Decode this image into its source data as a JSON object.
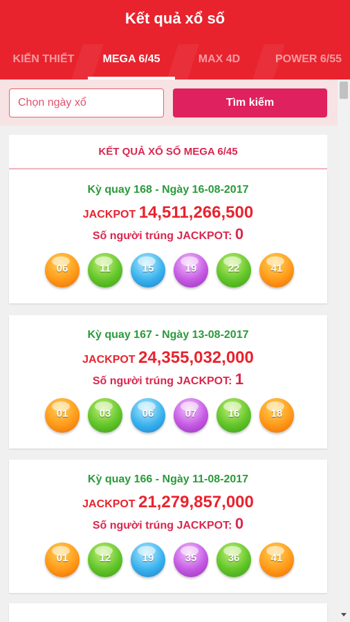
{
  "app": {
    "title": "Kết quả xổ số"
  },
  "tabs": [
    {
      "label": "KIẾN THIẾT",
      "active": false
    },
    {
      "label": "MEGA 6/45",
      "active": true
    },
    {
      "label": "MAX 4D",
      "active": false
    },
    {
      "label": "POWER 6/55",
      "active": false
    }
  ],
  "search": {
    "placeholder": "Chọn ngày xổ",
    "button_label": "Tìm kiếm"
  },
  "section": {
    "title": "KẾT QUẢ XỔ SỐ MEGA 6/45"
  },
  "labels": {
    "jackpot": "JACKPOT",
    "winners": "Số người trúng JACKPOT:"
  },
  "results": [
    {
      "draw": "Kỳ quay 168 - Ngày 16-08-2017",
      "jackpot": "14,511,266,500",
      "winners": "0",
      "balls": [
        {
          "number": "06",
          "color": "orange"
        },
        {
          "number": "11",
          "color": "green"
        },
        {
          "number": "15",
          "color": "blue"
        },
        {
          "number": "19",
          "color": "purple"
        },
        {
          "number": "22",
          "color": "green"
        },
        {
          "number": "41",
          "color": "orange"
        }
      ]
    },
    {
      "draw": "Kỳ quay 167 - Ngày 13-08-2017",
      "jackpot": "24,355,032,000",
      "winners": "1",
      "balls": [
        {
          "number": "01",
          "color": "orange"
        },
        {
          "number": "03",
          "color": "green"
        },
        {
          "number": "06",
          "color": "blue"
        },
        {
          "number": "07",
          "color": "purple"
        },
        {
          "number": "16",
          "color": "green"
        },
        {
          "number": "18",
          "color": "orange"
        }
      ]
    },
    {
      "draw": "Kỳ quay 166 - Ngày 11-08-2017",
      "jackpot": "21,279,857,000",
      "winners": "0",
      "balls": [
        {
          "number": "01",
          "color": "orange"
        },
        {
          "number": "12",
          "color": "green"
        },
        {
          "number": "19",
          "color": "blue"
        },
        {
          "number": "35",
          "color": "purple"
        },
        {
          "number": "36",
          "color": "green"
        },
        {
          "number": "41",
          "color": "orange"
        }
      ]
    }
  ],
  "colors": {
    "header": "#e8232e",
    "accent": "#e0215f",
    "draw_text": "#2a9a3a",
    "jackpot_text": "#e8232e",
    "ball_orange": "#ff9a1a",
    "ball_green": "#62c62a",
    "ball_blue": "#3ab2ee",
    "ball_purple": "#c55ae3"
  }
}
